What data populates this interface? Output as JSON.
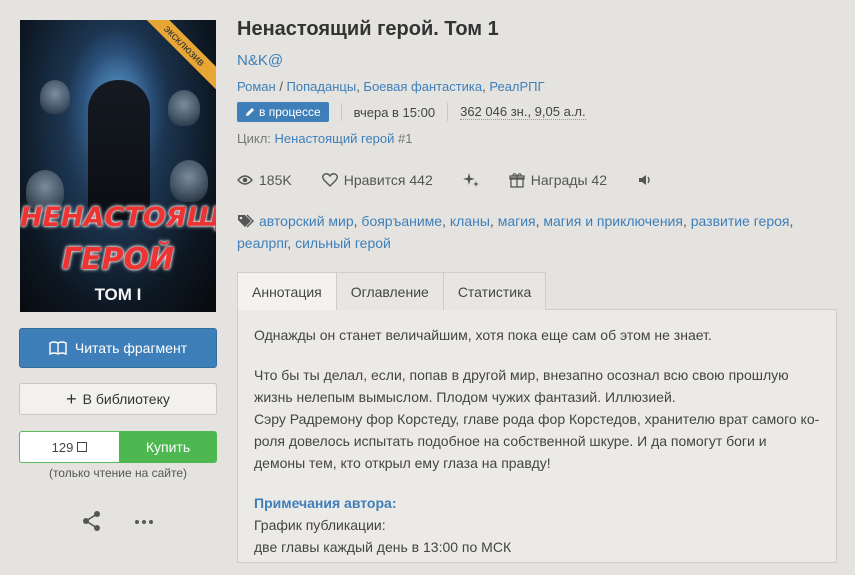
{
  "book": {
    "title": "Ненастоящий герой. Том 1",
    "author": "N&K@",
    "cover": {
      "title_line1": "НЕНАСТОЯЩИЙ",
      "title_line2": "ГЕРОЙ",
      "volume": "ТОМ I",
      "ribbon": "эксклюзив"
    },
    "genres": [
      "Роман",
      "Попаданцы",
      "Боевая фантастика",
      "РеалРПГ"
    ],
    "status_badge": "в процессе",
    "updated": "вчера в 15:00",
    "size": "362 046 зн., 9,05 а.л.",
    "cycle_label": "Цикл:",
    "cycle_name": "Ненастоящий герой",
    "cycle_num": "#1"
  },
  "stats": {
    "views": "185K",
    "likes": "Нравится 442",
    "awards": "Награды 42"
  },
  "tags": [
    "авторский мир",
    "бояръаниме",
    "кланы",
    "магия",
    "магия и приключения",
    "развитие героя",
    "реалрпг",
    "сильный герой"
  ],
  "actions": {
    "read_fragment": "Читать фрагмент",
    "add_library": "В библиотеку",
    "price": "129",
    "buy": "Купить",
    "site_note": "(только чтение на сайте)"
  },
  "tabs": [
    "Аннотация",
    "Оглавление",
    "Статистика"
  ],
  "annotation": {
    "p1": "Однажды он станет величайшим, хотя пока еще сам об этом не знает.",
    "p2": "Что бы ты делал, если, попав в другой мир, внезапно осознал всю свою прошлую жизнь нелепым вымыслом. Плодом чужих фантазий. Иллюзией.",
    "p3": "Сэру Радремону фор Корстеду, главе рода фор Корстедов, хранителю врат самого ко-роля довелось испытать подобное на собственной шкуре. И да помогут боги и демоны тем, кто открыл ему глаза на правду!",
    "note_head": "Примечания автора:",
    "note1": "График публикации:",
    "note2": "две главы каждый день в 13:00 по МСК"
  }
}
